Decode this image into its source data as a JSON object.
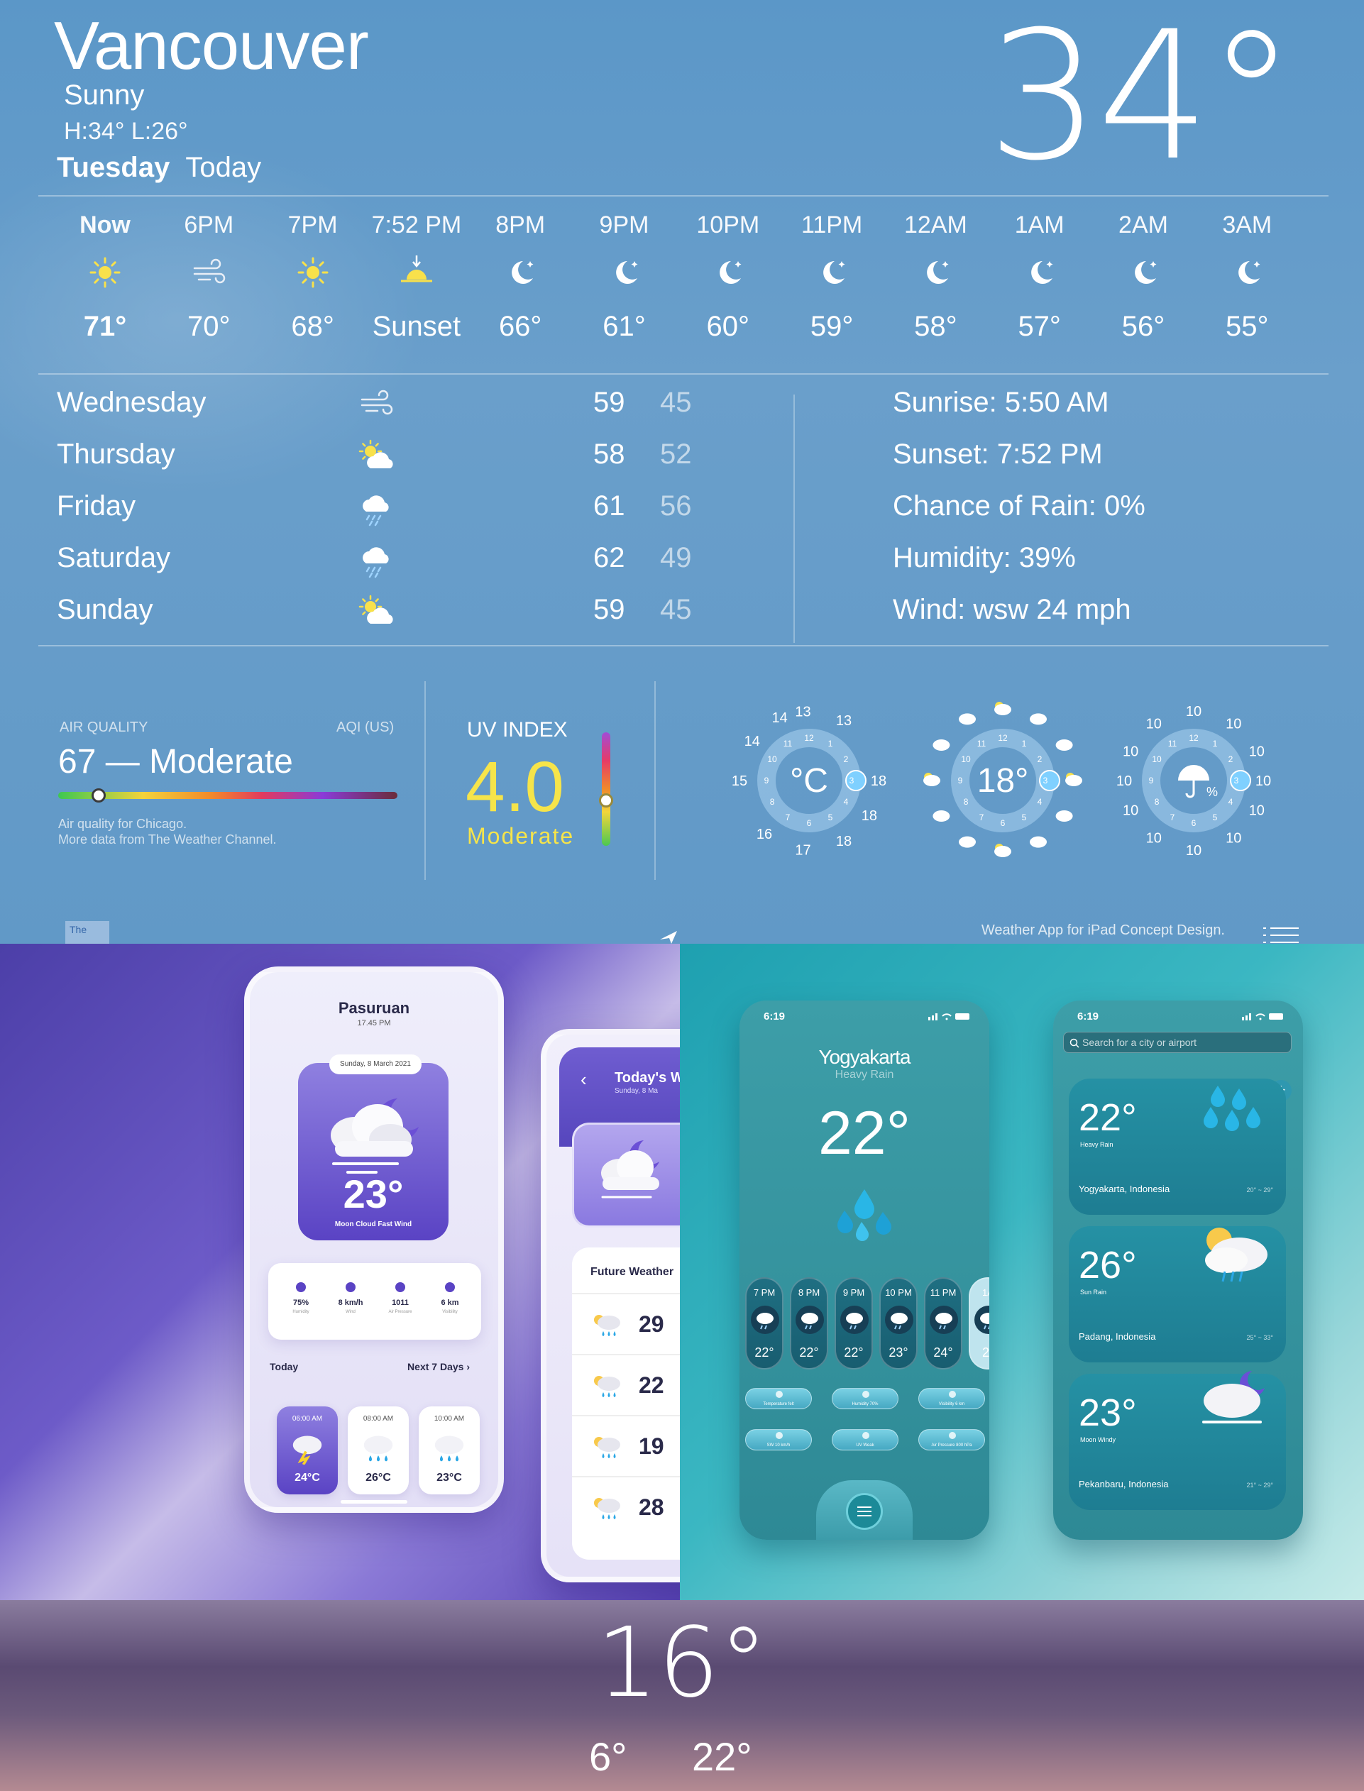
{
  "ipad": {
    "city": "Vancouver",
    "condition": "Sunny",
    "hilo": "H:34° L:26°",
    "day": "Tuesday",
    "day_rel": "Today",
    "current_temp": "34°",
    "hourly": [
      {
        "time": "Now",
        "icon": "sun-icon",
        "value": "71°"
      },
      {
        "time": "6PM",
        "icon": "wind-icon",
        "value": "70°"
      },
      {
        "time": "7PM",
        "icon": "sun-icon",
        "value": "68°"
      },
      {
        "time": "7:52 PM",
        "icon": "sunset-icon",
        "value": "Sunset"
      },
      {
        "time": "8PM",
        "icon": "moon-icon",
        "value": "66°"
      },
      {
        "time": "9PM",
        "icon": "moon-icon",
        "value": "61°"
      },
      {
        "time": "10PM",
        "icon": "moon-icon",
        "value": "60°"
      },
      {
        "time": "11PM",
        "icon": "moon-icon",
        "value": "59°"
      },
      {
        "time": "12AM",
        "icon": "moon-icon",
        "value": "58°"
      },
      {
        "time": "1AM",
        "icon": "moon-icon",
        "value": "57°"
      },
      {
        "time": "2AM",
        "icon": "moon-icon",
        "value": "56°"
      },
      {
        "time": "3AM",
        "icon": "moon-icon",
        "value": "55°"
      }
    ],
    "daily": [
      {
        "day": "Wednesday",
        "icon": "wind-icon",
        "hi": "59",
        "lo": "45"
      },
      {
        "day": "Thursday",
        "icon": "partly-sunny-icon",
        "hi": "58",
        "lo": "52"
      },
      {
        "day": "Friday",
        "icon": "rain-cloud-icon",
        "hi": "61",
        "lo": "56"
      },
      {
        "day": "Saturday",
        "icon": "rain-cloud-icon",
        "hi": "62",
        "lo": "49"
      },
      {
        "day": "Sunday",
        "icon": "partly-sunny-icon",
        "hi": "59",
        "lo": "45"
      }
    ],
    "facts": [
      "Sunrise: 5:50 AM",
      "Sunset: 7:52 PM",
      "Chance of Rain: 0%",
      "Humidity: 39%",
      "Wind: wsw 24 mph"
    ],
    "air_quality": {
      "label": "AIR QUALITY",
      "scale": "AQI (US)",
      "value": "67 — Moderate",
      "level": 0.12,
      "note_1": "Air quality for Chicago.",
      "note_2": "More data from The Weather Channel."
    },
    "uv": {
      "label": "UV INDEX",
      "value": "4.0",
      "word": "Moderate",
      "level": 0.4
    },
    "dial_temp": {
      "center": "°C",
      "ring": [
        "13",
        "13",
        "18",
        "18",
        "18",
        "17",
        "16",
        "15",
        "14",
        "14"
      ],
      "inner": [
        "12",
        "1",
        "2",
        "3",
        "4",
        "5",
        "6",
        "7",
        "8",
        "9",
        "10",
        "11"
      ]
    },
    "dial_weather": {
      "center": "18°"
    },
    "dial_rain": {
      "ring": [
        "10",
        "10",
        "10",
        "10",
        "10",
        "10",
        "10",
        "10",
        "10",
        "10",
        "10",
        "10"
      ],
      "inner": [
        "12",
        "1",
        "2",
        "3",
        "4",
        "5",
        "6",
        "7",
        "8",
        "9",
        "10",
        "11"
      ]
    },
    "footer_note": "Weather App for iPad Concept Design.",
    "footer_logo": "The"
  },
  "purple": {
    "city": "Pasuruan",
    "time": "17.45 PM",
    "date": "Sunday, 8 March 2021",
    "temp": "23°",
    "condition": "Moon Cloud Fast Wind",
    "stats": [
      {
        "icon": "droplet-icon",
        "value": "75%",
        "label": "Humidity"
      },
      {
        "icon": "wind-icon",
        "value": "8 km/h",
        "label": "Wind"
      },
      {
        "icon": "gauge-icon",
        "value": "1011",
        "label": "Air Pressure"
      },
      {
        "icon": "eye-icon",
        "value": "6 km",
        "label": "Visibility"
      }
    ],
    "today": "Today",
    "next": "Next 7 Days",
    "hours": [
      {
        "time": "06:00 AM",
        "value": "24°C"
      },
      {
        "time": "08:00 AM",
        "value": "26°C"
      },
      {
        "time": "10:00 AM",
        "value": "23°C"
      }
    ],
    "phone2_title": "Today's W",
    "phone2_sub": "Sunday, 8 Ma",
    "future_title": "Future Weather",
    "future": [
      "29",
      "22",
      "19",
      "28"
    ]
  },
  "teal": {
    "status_time": "6:19",
    "city": "Yogyakarta",
    "condition": "Heavy Rain",
    "temp": "22°",
    "hours": [
      {
        "time": "7 PM",
        "value": "22°"
      },
      {
        "time": "8 PM",
        "value": "22°"
      },
      {
        "time": "9 PM",
        "value": "22°"
      },
      {
        "time": "10 PM",
        "value": "23°"
      },
      {
        "time": "11 PM",
        "value": "24°"
      },
      {
        "time": "1A",
        "value": "2("
      }
    ],
    "chips": [
      "Temperature felt",
      "Humidity 70%",
      "Visibility 6 km",
      "SW 10 km/h",
      "UV Weak",
      "Air Pressure 800 hPa"
    ],
    "search_placeholder": "Search for a city or airport",
    "cities": [
      {
        "temp": "22°",
        "cond": "Heavy Rain",
        "name": "Yogyakarta, Indonesia",
        "range": "20° ~ 29°"
      },
      {
        "temp": "26°",
        "cond": "Sun Rain",
        "name": "Padang, Indonesia",
        "range": "25° ~ 33°"
      },
      {
        "temp": "23°",
        "cond": "Moon Windy",
        "name": "Pekanbaru, Indonesia",
        "range": "21° ~ 29°"
      }
    ]
  },
  "bottom": {
    "temp": "16°",
    "low": "6°",
    "high": "22°"
  }
}
